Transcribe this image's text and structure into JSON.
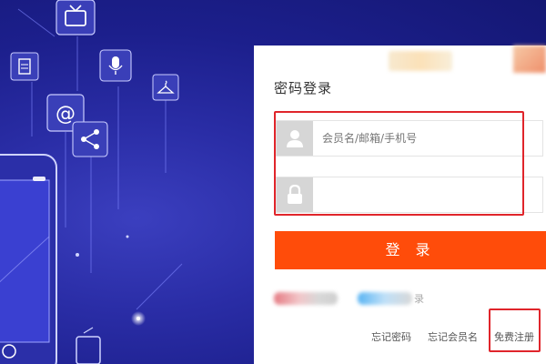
{
  "login": {
    "title": "密码登录",
    "username": {
      "placeholder": "会员名/邮箱/手机号",
      "icon": "user-icon"
    },
    "password": {
      "placeholder": "",
      "icon": "lock-icon"
    },
    "submit_label": "登 录",
    "partial_text": "录",
    "links": {
      "forgot_password": "忘记密码",
      "forgot_username": "忘记会员名",
      "register": "免费注册"
    }
  },
  "colors": {
    "accent": "#ff4c0a",
    "highlight_box": "#e0252b",
    "background": "#1c1f8c"
  },
  "background_icons": [
    "tv-icon",
    "document-icon",
    "microphone-icon",
    "hanger-icon",
    "at-icon",
    "share-icon",
    "phone-illustration"
  ]
}
